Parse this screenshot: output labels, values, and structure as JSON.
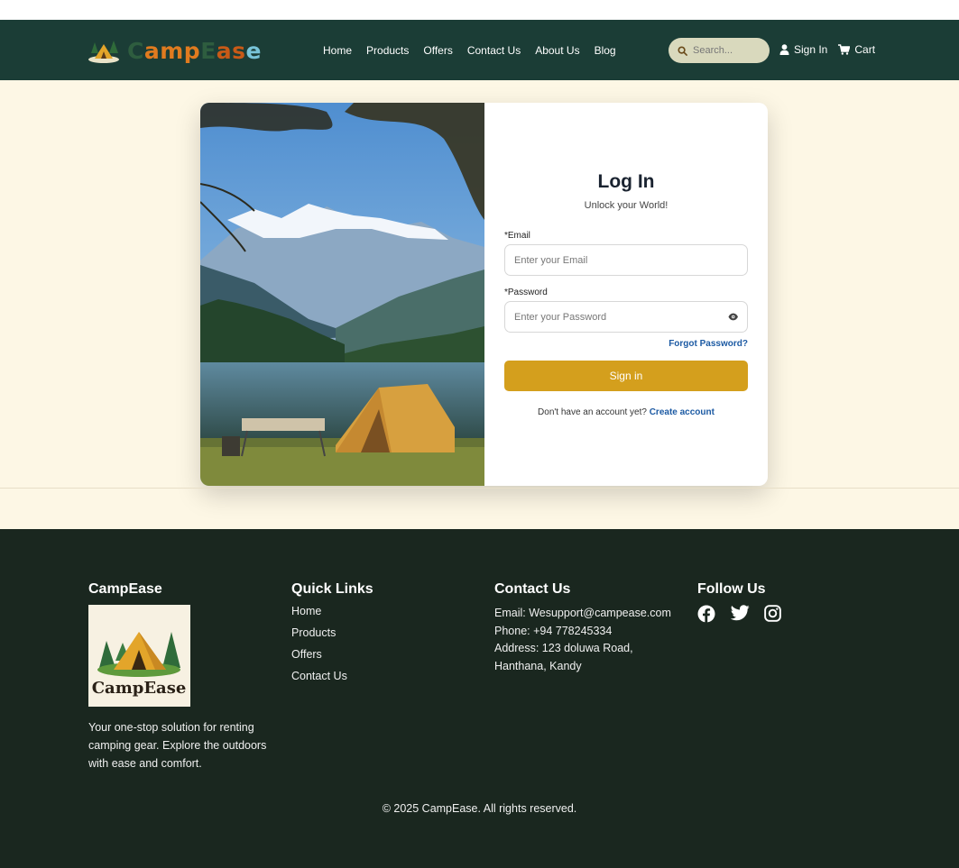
{
  "brand": {
    "name": "CampEase",
    "logo_letters": [
      {
        "ch": "C",
        "color": "#2e5d3f"
      },
      {
        "ch": "a",
        "color": "#e07b1f"
      },
      {
        "ch": "m",
        "color": "#e07b1f"
      },
      {
        "ch": "p",
        "color": "#e07b1f"
      },
      {
        "ch": "E",
        "color": "#2e5d3f"
      },
      {
        "ch": "a",
        "color": "#c85a17"
      },
      {
        "ch": "s",
        "color": "#c85a17"
      },
      {
        "ch": "e",
        "color": "#78c4d8"
      }
    ]
  },
  "nav": {
    "links": [
      "Home",
      "Products",
      "Offers",
      "Contact Us",
      "About Us",
      "Blog"
    ],
    "search_placeholder": "Search...",
    "sign_in": "Sign In",
    "cart": "Cart"
  },
  "login": {
    "title": "Log In",
    "subtitle": "Unlock your World!",
    "email_label": "*Email",
    "email_placeholder": "Enter your Email",
    "password_label": "*Password",
    "password_placeholder": "Enter your Password",
    "forgot": "Forgot Password?",
    "submit": "Sign in",
    "no_account": "Don't have an account yet?",
    "create_account": "Create account"
  },
  "footer": {
    "brand_title": "CampEase",
    "brand_logo_text": "CampEase",
    "description": "Your one-stop solution for renting camping gear. Explore the outdoors with ease and comfort.",
    "quick_links_title": "Quick Links",
    "quick_links": [
      "Home",
      "Products",
      "Offers",
      "Contact Us"
    ],
    "contact_title": "Contact Us",
    "contact": {
      "email": "Email: Wesupport@campease.com",
      "phone": "Phone: +94 778245334",
      "address_1": "Address: 123 doluwa Road,",
      "address_2": "Hanthana, Kandy"
    },
    "follow_title": "Follow Us",
    "social": [
      "facebook-icon",
      "twitter-icon",
      "instagram-icon"
    ],
    "copyright": "© 2025 CampEase. All rights reserved."
  },
  "colors": {
    "nav_bg": "#1b3d36",
    "page_bg": "#fdf7e5",
    "accent": "#d49f1d",
    "link": "#1c5aa3",
    "footer_bg": "#1a271f"
  }
}
